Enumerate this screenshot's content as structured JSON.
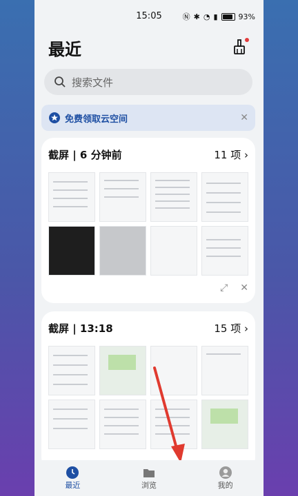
{
  "status": {
    "time": "15:05",
    "battery": "93%"
  },
  "page": {
    "title": "最近"
  },
  "search": {
    "placeholder": "搜索文件"
  },
  "banner": {
    "text": "免费领取云空间"
  },
  "groups": [
    {
      "title": "截屏 | 6 分钟前",
      "count": "11 项"
    },
    {
      "title": "截屏 | 13:18",
      "count": "15 项"
    }
  ],
  "nav": {
    "recent": "最近",
    "browse": "浏览",
    "mine": "我的"
  },
  "colors": {
    "accent": "#1e4fa3",
    "badge": "#e23b3b",
    "arrow": "#e03a2f"
  }
}
